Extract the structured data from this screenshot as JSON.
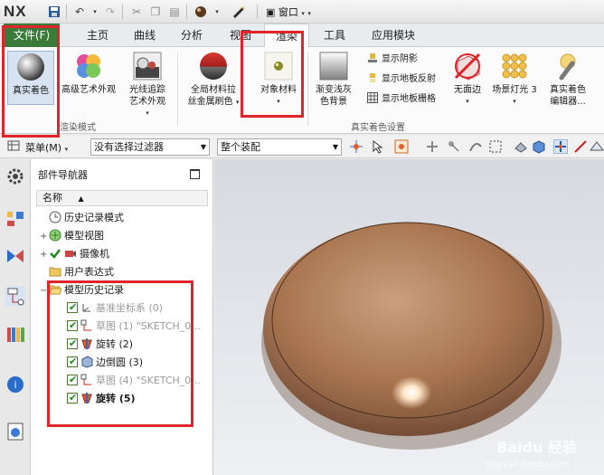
{
  "app": {
    "logo": "NX",
    "window_menu": "窗口"
  },
  "tabs": [
    "文件(F)",
    "主页",
    "曲线",
    "分析",
    "视图",
    "渲染",
    "工具",
    "应用模块"
  ],
  "ribbon": {
    "true_shading": "真实着色",
    "advanced_art": "高级艺术外观",
    "raytrace_line1": "光线追踪",
    "raytrace_line2": "艺术外观",
    "group_render_mode": "渲染模式",
    "global_mat_line1": "全局材料拉",
    "global_mat_line2": "丝金属刷色",
    "object_material": "对象材料",
    "gradient_line1": "渐变浅灰",
    "gradient_line2": "色背景",
    "show_shadow": "显示阴影",
    "show_floor_reflect": "显示地板反射",
    "show_floor_grid": "显示地板栅格",
    "no_edge": "无面边",
    "scene_light": "场景灯光 3",
    "shading_editor_line1": "真实着色",
    "shading_editor_line2": "编辑器...",
    "group_true_shading_settings": "真实着色设置"
  },
  "cmdbar": {
    "menu_label": "菜单(M)",
    "filter": "没有选择过滤器",
    "assembly": "整个装配"
  },
  "navigator": {
    "title": "部件导航器",
    "col_name": "名称",
    "rows": [
      {
        "label": "历史记录模式"
      },
      {
        "label": "模型视图"
      },
      {
        "label": "摄像机"
      },
      {
        "label": "用户表达式"
      },
      {
        "label": "模型历史记录"
      },
      {
        "label": "基准坐标系 (0)"
      },
      {
        "label": "草图 (1) \"SKETCH_0..."
      },
      {
        "label": "旋转 (2)"
      },
      {
        "label": "边倒圆 (3)"
      },
      {
        "label": "草图 (4) \"SKETCH_0..."
      },
      {
        "label": "旋转 (5)"
      }
    ]
  },
  "watermark": {
    "brand": "Baidu 经验",
    "url": "jingyan.baidu.com"
  },
  "colors": {
    "file_tab": "#3a7b3a",
    "annotation": "#e0242b",
    "part": "#b98a6a"
  }
}
